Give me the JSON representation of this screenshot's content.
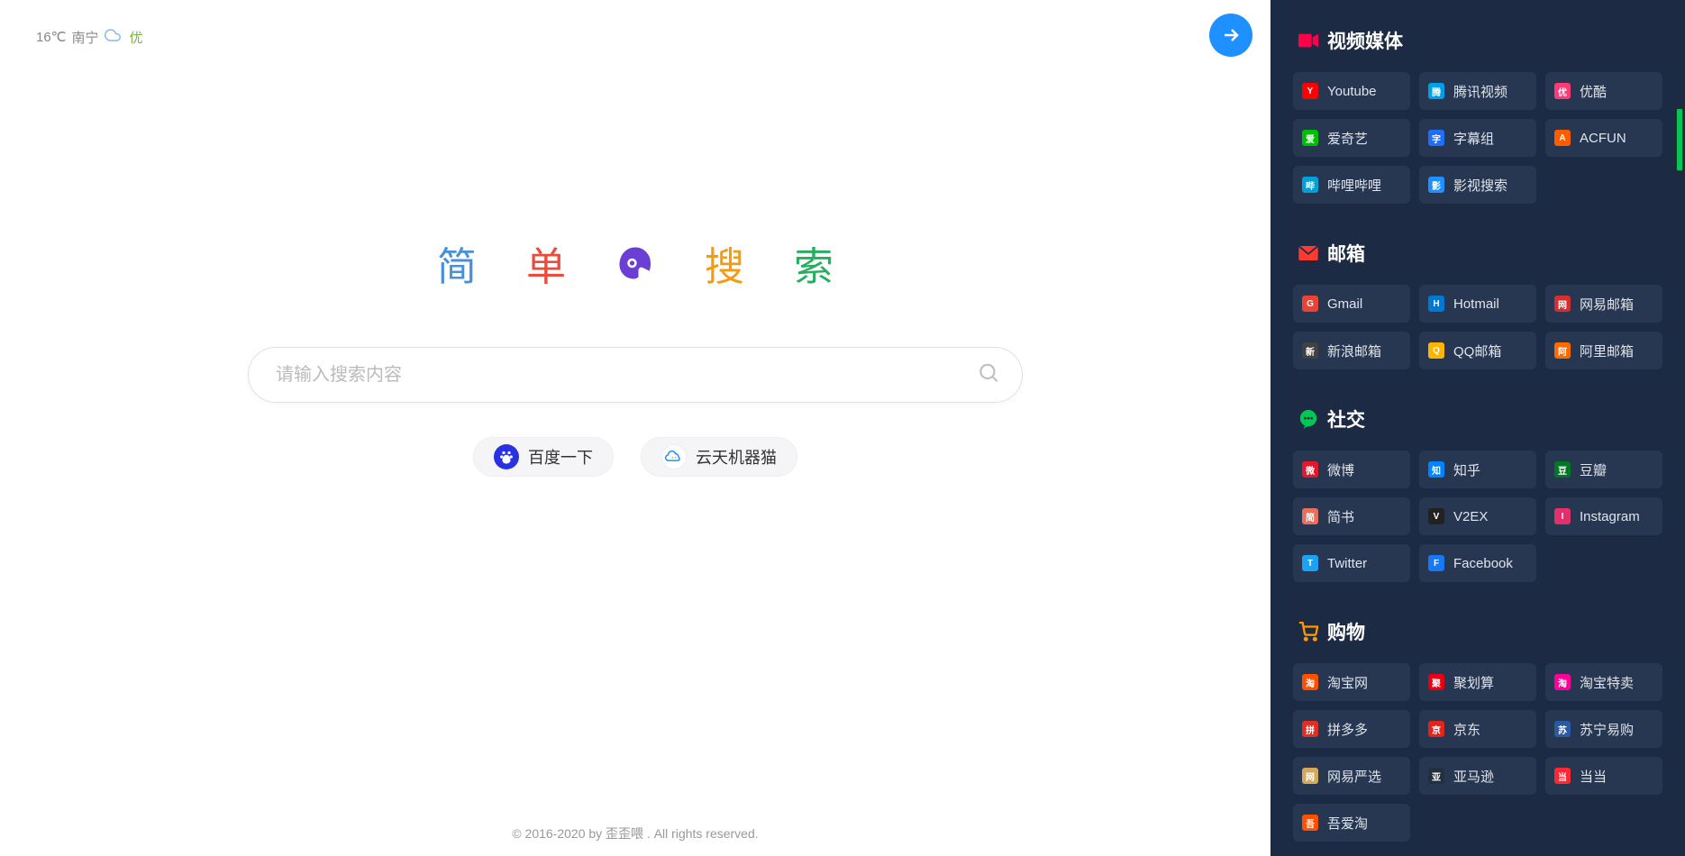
{
  "weather": {
    "temp": "16℃",
    "city": "南宁",
    "aqi": "优"
  },
  "logo": {
    "chars": [
      "简",
      "单",
      "搜",
      "索"
    ],
    "colors": [
      "#4a90d9",
      "#e74c3c",
      "#f39c12",
      "#27ae60"
    ]
  },
  "search": {
    "placeholder": "请输入搜索内容"
  },
  "engines": [
    {
      "label": "百度一下",
      "icon_bg": "#2932e1"
    },
    {
      "label": "云天机器猫",
      "icon_bg": "#ffffff"
    }
  ],
  "footer": "© 2016-2020 by 歪歪喂 . All rights reserved.",
  "sidebar": {
    "sections": [
      {
        "title": "视频媒体",
        "icon_color": "#ff0048",
        "icon": "video",
        "links": [
          {
            "label": "Youtube",
            "icon_bg": "#ff0000"
          },
          {
            "label": "腾讯视频",
            "icon_bg": "#00a0e9"
          },
          {
            "label": "优酷",
            "icon_bg": "#ff3b77"
          },
          {
            "label": "爱奇艺",
            "icon_bg": "#00be06"
          },
          {
            "label": "字幕组",
            "icon_bg": "#1e6fff"
          },
          {
            "label": "ACFUN",
            "icon_bg": "#ff5c00"
          },
          {
            "label": "哔哩哔哩",
            "icon_bg": "#00a1d6"
          },
          {
            "label": "影视搜索",
            "icon_bg": "#1e90ff"
          }
        ]
      },
      {
        "title": "邮箱",
        "icon_color": "#ff3b30",
        "icon": "mail",
        "links": [
          {
            "label": "Gmail",
            "icon_bg": "#ea4335"
          },
          {
            "label": "Hotmail",
            "icon_bg": "#0078d4"
          },
          {
            "label": "网易邮箱",
            "icon_bg": "#d32f2f"
          },
          {
            "label": "新浪邮箱",
            "icon_bg": "#414141"
          },
          {
            "label": "QQ邮箱",
            "icon_bg": "#ffb400"
          },
          {
            "label": "阿里邮箱",
            "icon_bg": "#ff6a00"
          }
        ]
      },
      {
        "title": "社交",
        "icon_color": "#00c853",
        "icon": "chat",
        "links": [
          {
            "label": "微博",
            "icon_bg": "#e6162d"
          },
          {
            "label": "知乎",
            "icon_bg": "#0084ff"
          },
          {
            "label": "豆瓣",
            "icon_bg": "#007722"
          },
          {
            "label": "简书",
            "icon_bg": "#ea6f5a"
          },
          {
            "label": "V2EX",
            "icon_bg": "#222222"
          },
          {
            "label": "Instagram",
            "icon_bg": "#e1306c"
          },
          {
            "label": "Twitter",
            "icon_bg": "#1da1f2"
          },
          {
            "label": "Facebook",
            "icon_bg": "#1877f2"
          }
        ]
      },
      {
        "title": "购物",
        "icon_color": "#ff9800",
        "icon": "cart",
        "links": [
          {
            "label": "淘宝网",
            "icon_bg": "#ff5000"
          },
          {
            "label": "聚划算",
            "icon_bg": "#e60012"
          },
          {
            "label": "淘宝特卖",
            "icon_bg": "#ff0099"
          },
          {
            "label": "拼多多",
            "icon_bg": "#e02e24"
          },
          {
            "label": "京东",
            "icon_bg": "#e1251b"
          },
          {
            "label": "苏宁易购",
            "icon_bg": "#2b5aa5"
          },
          {
            "label": "网易严选",
            "icon_bg": "#d4a95b"
          },
          {
            "label": "亚马逊",
            "icon_bg": "#232f3e"
          },
          {
            "label": "当当",
            "icon_bg": "#ff2832"
          },
          {
            "label": "吾爱淘",
            "icon_bg": "#ff5000"
          }
        ]
      }
    ]
  }
}
